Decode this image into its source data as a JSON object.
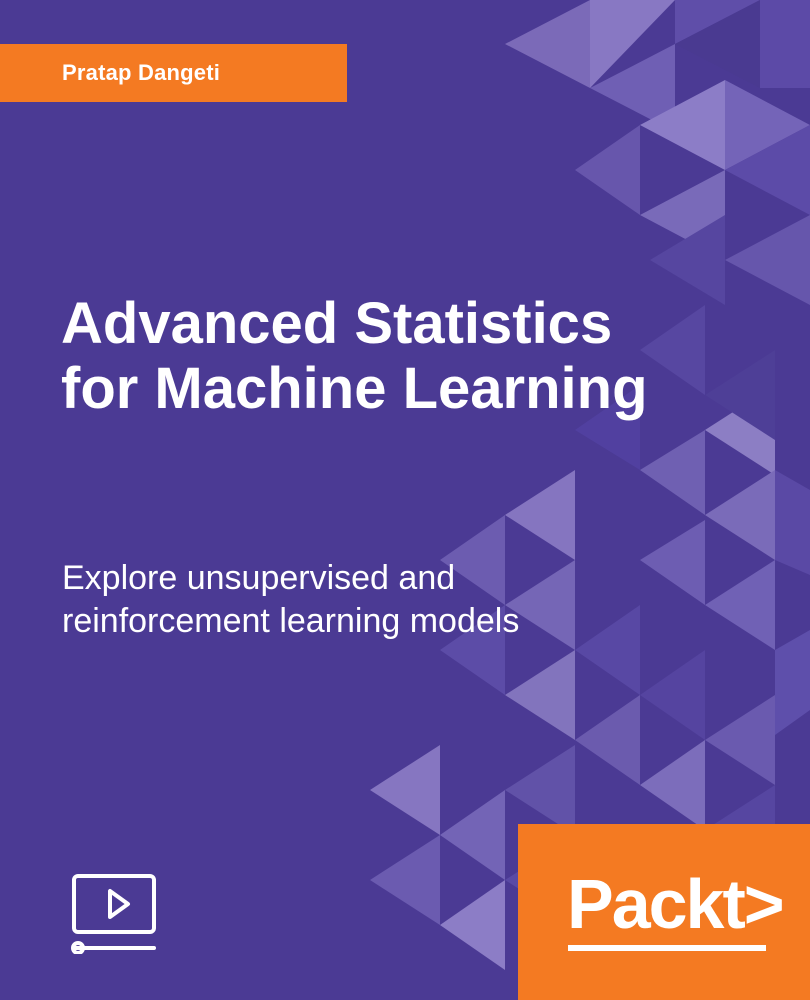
{
  "cover": {
    "author": "Pratap Dangeti",
    "title_lines": [
      "Advanced Statistics",
      "for Machine Learning"
    ],
    "subtitle_lines": [
      "Explore unsupervised and",
      "reinforcement learning models"
    ],
    "publisher": "Packt",
    "publisher_logo_glyph": ">",
    "icons": {
      "video": "video-play-icon"
    },
    "colors": {
      "background": "#4b3a94",
      "accent": "#f47a22",
      "text": "#ffffff"
    }
  }
}
